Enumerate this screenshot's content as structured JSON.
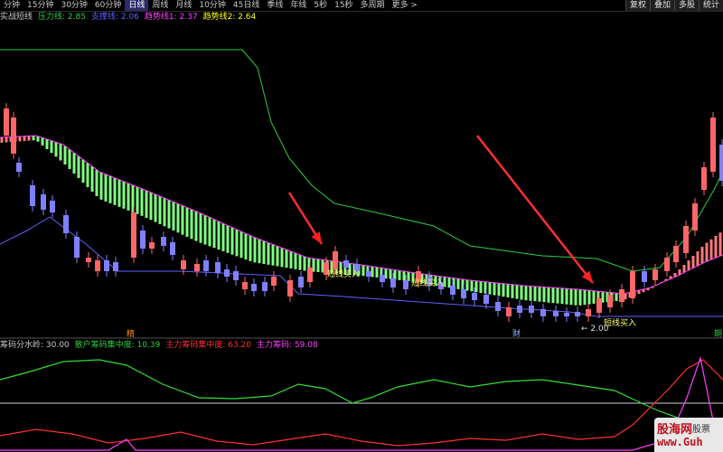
{
  "toolbar": {
    "periods": [
      "分钟",
      "15分钟",
      "30分钟",
      "60分钟",
      "日线",
      "周线",
      "月线",
      "10分钟",
      "45日线",
      "季线",
      "年线",
      "5秒",
      "15秒",
      "多周期",
      "更多 >"
    ],
    "active_period": "日线",
    "right_buttons": [
      "复权",
      "叠加",
      "多股",
      "统计"
    ]
  },
  "main_legend": {
    "title": "实战短线",
    "items": [
      {
        "label": "压力线:",
        "value": "2.85",
        "color": "#2ecc40"
      },
      {
        "label": "支撑线:",
        "value": "2.06",
        "color": "#6060ff"
      },
      {
        "label": "趋势线1:",
        "value": "2.37",
        "color": "#ff40ff"
      },
      {
        "label": "趋势线2:",
        "value": "2.64",
        "color": "#ffff00"
      }
    ]
  },
  "sub_legend": {
    "title": "筹码分水岭: 30.00",
    "items": [
      {
        "label": "散户筹码集中度:",
        "value": "10.39",
        "color": "#2ecc40"
      },
      {
        "label": "主力筹码集中度:",
        "value": "63.20",
        "color": "#ff3030"
      },
      {
        "label": "主力筹码:",
        "value": "59.08",
        "color": "#ff40ff"
      }
    ]
  },
  "annotations": {
    "buy_signal_1": "短线买入",
    "buy_signal_2": "短线买入",
    "buy_signal_3": "短线买入",
    "low_price": "← 2.00",
    "marker_left": "精",
    "marker_mid": "财",
    "marker_right": "期"
  },
  "watermark": {
    "line1": "股海网",
    "line1b": "股票",
    "line2": "www.Guh"
  },
  "colors": {
    "up": "#ff6666",
    "down": "#8080ff",
    "band": "#80ff80",
    "pressure": "#2ecc40",
    "support": "#6060ff",
    "arrow": "#ff2020"
  }
}
